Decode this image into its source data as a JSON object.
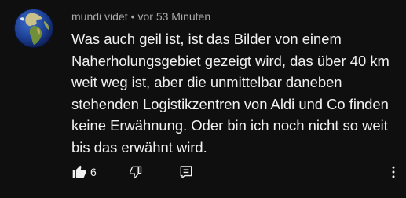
{
  "comment": {
    "author": "mundi videt",
    "separator": "•",
    "timestamp": "vor 53 Minuten",
    "text_lines": [
      "Was auch geil ist, ist das Bilder von einem",
      "Naherholungsgebiet gezeigt wird, das über 40 km",
      "weit weg ist, aber die unmittelbar daneben",
      "stehenden Logistikzentren von Aldi und Co finden",
      "keine Erwähnung. Oder bin ich noch nicht so weit",
      "bis das erwähnt wird."
    ],
    "like_count": "6"
  },
  "icons": {
    "avatar": "globe-avatar",
    "like": "thumbs-up-icon",
    "dislike": "thumbs-down-icon",
    "reply": "reply-icon",
    "menu": "more-vertical-icon"
  },
  "colors": {
    "background": "#0f0f0f",
    "text": "#f1f1f1",
    "meta": "#aaaaaa"
  }
}
